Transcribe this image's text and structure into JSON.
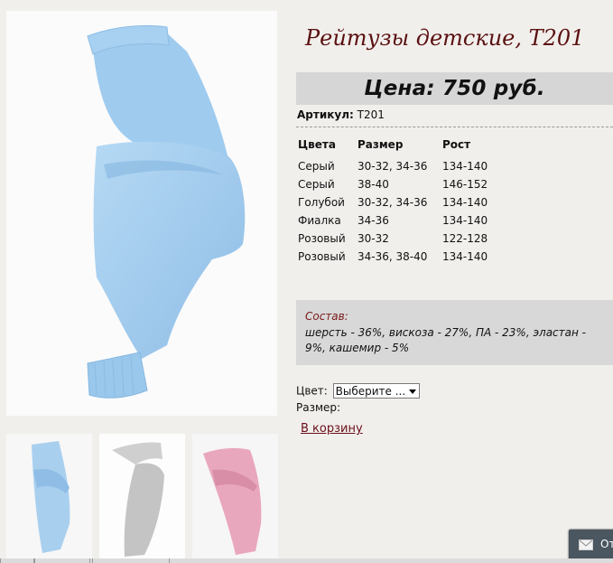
{
  "product": {
    "title": "Рейтузы детские, Т201",
    "price": "Цена: 750 руб.",
    "sku_label": "Артикул:",
    "sku_value": "Т201"
  },
  "variants": {
    "headers": [
      "Цвета",
      "Размер",
      "Рост"
    ],
    "rows": [
      [
        "Серый",
        "30-32, 34-36",
        "134-140"
      ],
      [
        "Серый",
        "38-40",
        "146-152"
      ],
      [
        "Голубой",
        "30-32, 34-36",
        "134-140"
      ],
      [
        "Фиалка",
        "34-36",
        "134-140"
      ],
      [
        "Розовый",
        "30-32",
        "122-128"
      ],
      [
        "Розовый",
        "34-36, 38-40",
        "134-140"
      ]
    ]
  },
  "composition": {
    "label": "Состав:",
    "text": "шерсть - 36%, вискоза - 27%, ПА - 23%, эластан - 9%, кашемир - 5%"
  },
  "options": {
    "color_label": "Цвет:",
    "color_selected": "Выберите ...",
    "size_label": "Размер:"
  },
  "cart_link": "В корзину",
  "chat_button": "От",
  "images": {
    "main_color": "#a9cfee",
    "thumbs": [
      "#a9cfee",
      "#c9c9c9",
      "#e9a7bd"
    ]
  }
}
